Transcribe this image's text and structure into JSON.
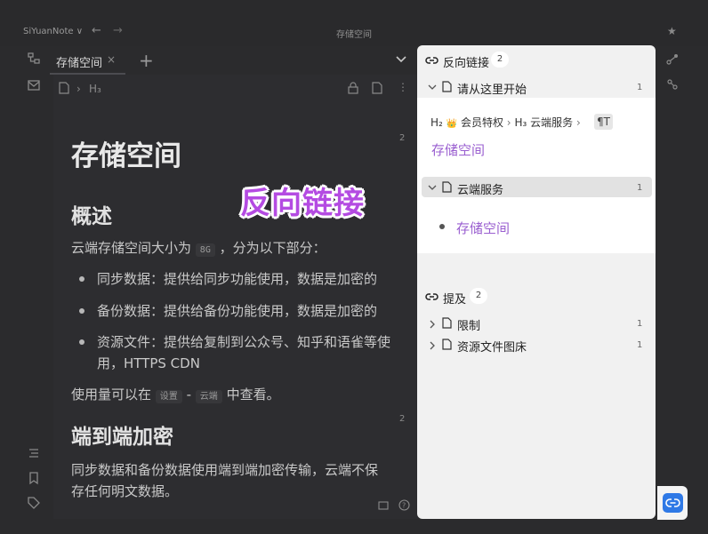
{
  "app": {
    "name": "SiYuanNote",
    "name_suffix": "∨",
    "window_title": "存储空间"
  },
  "tab": {
    "label": "存储空间",
    "close": "×",
    "add": "+"
  },
  "breadcrumb": {
    "heading": "H₃"
  },
  "editor": {
    "title": "存储空间",
    "section1": {
      "heading": "概述",
      "intro_before": "云端存储空间大小为",
      "intro_code": "8G",
      "intro_after": "，分为以下部分：",
      "items": [
        "同步数据：提供给同步功能使用，数据是加密的",
        "备份数据：提供给备份功能使用，数据是加密的",
        "资源文件：提供给复制到公众号、知乎和语雀等使",
        "用，HTTPS CDN"
      ],
      "usage_before": "使用量可以在",
      "usage_code1": "设置",
      "usage_dash": "-",
      "usage_code2": "云端",
      "usage_after": "中查看。"
    },
    "section2": {
      "heading": "端到端加密",
      "line1": "同步数据和备份数据使用端到端加密传输，云端不保",
      "line2": "存任何明文数据。"
    },
    "gutter_marks": [
      "2",
      "2"
    ]
  },
  "overlay": {
    "text": "反向链接"
  },
  "backlinks": {
    "title": "反向链接",
    "count": "2",
    "groups": [
      {
        "label": "请从这里开始",
        "count": "1",
        "path": {
          "h2": "H₂",
          "crown": "👑",
          "item1": "会员特权",
          "h3": "H₃",
          "item2": "云端服务",
          "para": "¶T"
        },
        "link": "存储空间"
      },
      {
        "label": "云端服务",
        "count": "1",
        "link": "存储空间"
      }
    ]
  },
  "mentions": {
    "title": "提及",
    "count": "2",
    "items": [
      {
        "label": "限制",
        "count": "1"
      },
      {
        "label": "资源文件图床",
        "count": "1"
      }
    ]
  },
  "colors": {
    "accent": "#9a5fd0",
    "overlay": "#b44be2",
    "button": "#2f79e6"
  }
}
